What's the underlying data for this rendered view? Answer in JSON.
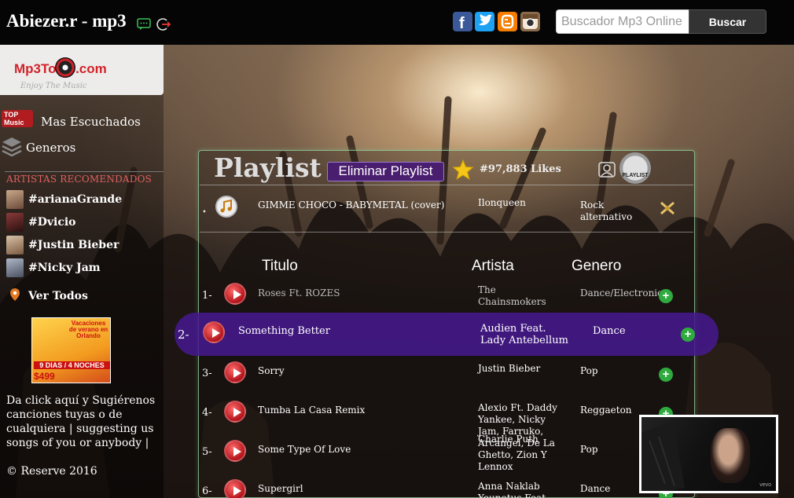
{
  "header": {
    "site_title": "Abiezer.r - mp3",
    "search_placeholder": "Buscador Mp3 Online",
    "search_button": "Buscar",
    "social_icons": [
      "facebook-icon",
      "twitter-icon",
      "blogger-icon",
      "instagram-icon"
    ]
  },
  "sidebar": {
    "logo": "Mp3Tonic.com",
    "logo_tagline": "Enjoy The Music",
    "nav": [
      {
        "label": "Mas Escuchados",
        "icon": "top-music-icon"
      },
      {
        "label": "Generos",
        "icon": "layers-icon"
      }
    ],
    "recommended_heading": "ARTISTAS RECOMENDADOS",
    "artists": [
      "#arianaGrande",
      "#Dvicio",
      "#Justin Bieber",
      "#Nicky Jam"
    ],
    "see_all": "Ver Todos",
    "ad": {
      "title": "Vacaciones de verano en Orlando",
      "days": "9 DIAS / 4 NOCHES",
      "price": "$499"
    },
    "suggest_text": "Da click aquí y Sugiérenos canciones tuyas o de cualquiera | suggesting us songs of you or anybody |",
    "copyright": "© Reserve 2016"
  },
  "playlist": {
    "title": "Playlist -",
    "delete_button": "Eliminar Playlist",
    "likes": "#97,883 Likes",
    "badge_label": "PLAYLIST",
    "now_playing": {
      "title": "GIMME CHOCO - BABYMETAL (cover)",
      "artist": "Ilonqueen",
      "genre": "Rock alternativo"
    },
    "columns": {
      "title": "Titulo",
      "artist": "Artista",
      "genre": "Genero"
    },
    "songs": [
      {
        "num": "1-",
        "title": "Roses Ft. ROZES",
        "artist": "The Chainsmokers",
        "genre": "Dance/Electronica"
      },
      {
        "num": "2-",
        "title": "Something Better",
        "artist": "Audien Feat. Lady Antebellum",
        "genre": "Dance"
      },
      {
        "num": "3-",
        "title": "Sorry",
        "artist": "Justin Bieber",
        "genre": "Pop"
      },
      {
        "num": "4-",
        "title": "Tumba La Casa Remix",
        "artist": "Alexio Ft. Daddy Yankee, Nicky Jam, Farruko, Arcangel, De La Ghetto, Zion Y Lennox",
        "genre": "Reggaeton"
      },
      {
        "num": "5-",
        "title": "Some Type Of Love",
        "artist": "Charlie Puth",
        "genre": "Pop"
      },
      {
        "num": "6-",
        "title": "Supergirl",
        "artist": "Anna Naklab Younotus Feat",
        "genre": "Dance"
      }
    ],
    "add_symbol": "+"
  },
  "video": {
    "watermark": "vevo"
  },
  "colors": {
    "accent_purple": "#4a1e6e",
    "play_red": "#b3141b",
    "add_green": "#2faa3f"
  }
}
